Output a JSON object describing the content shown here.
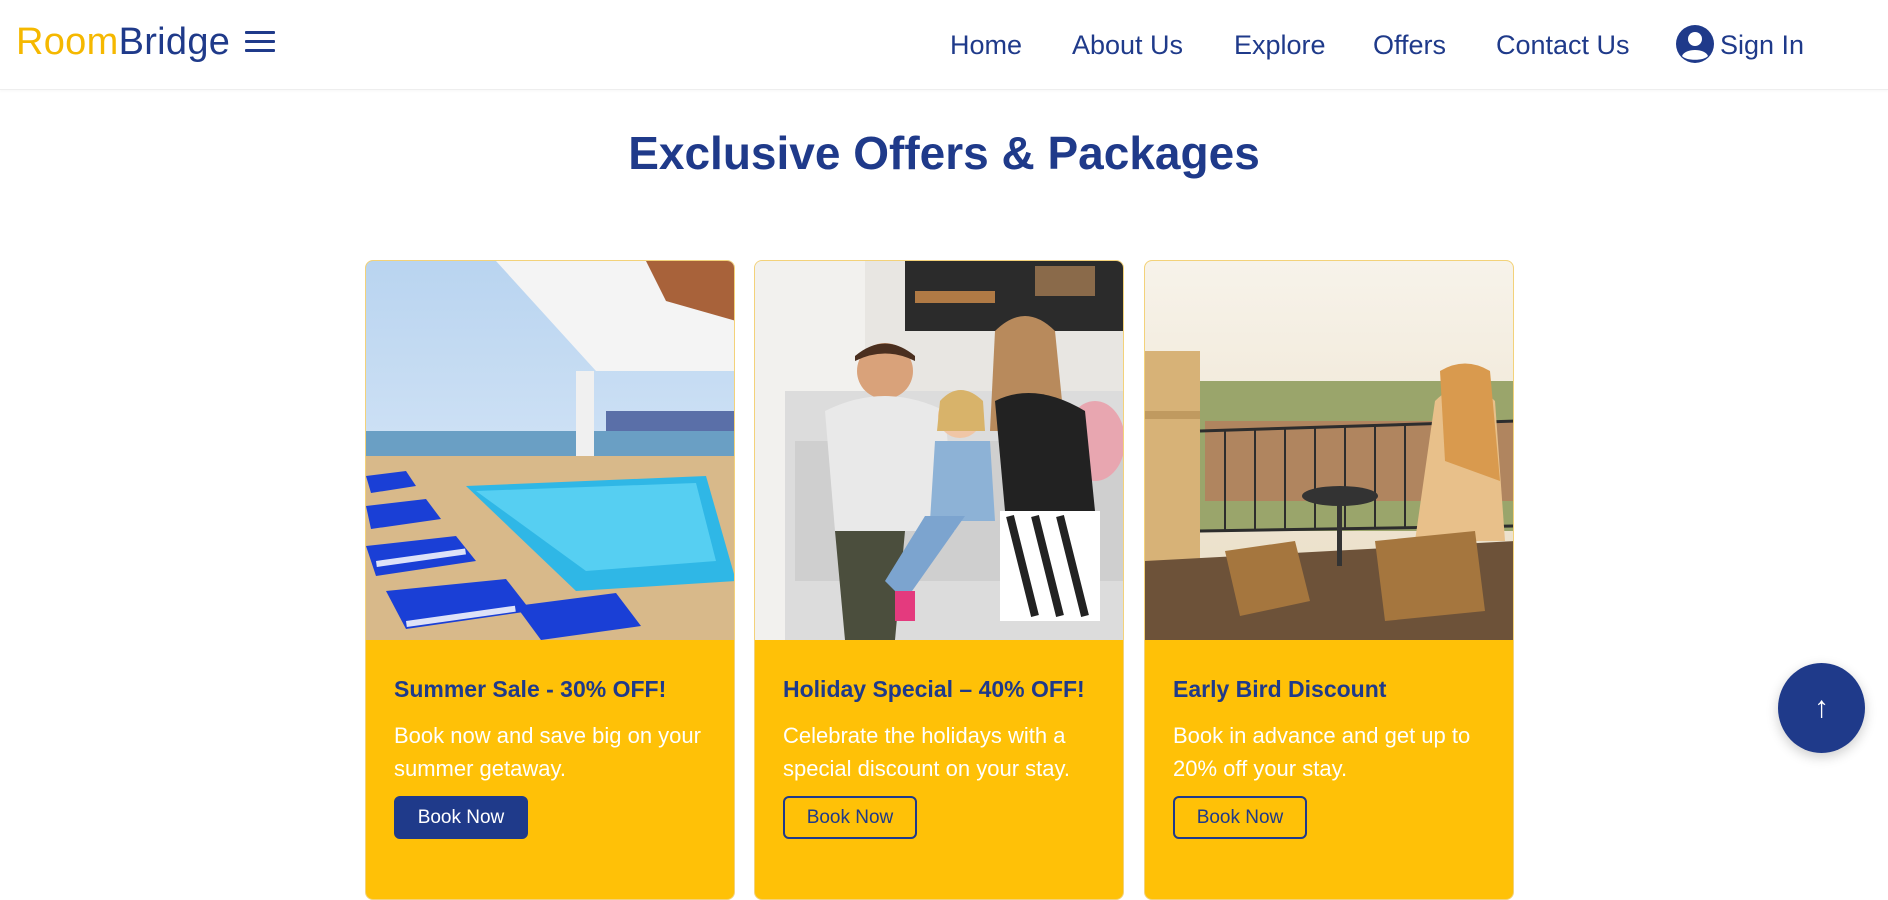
{
  "brand": {
    "part1": "Room",
    "part2": "Bridge"
  },
  "nav": {
    "items": [
      {
        "label": "Home"
      },
      {
        "label": "About Us"
      },
      {
        "label": "Explore"
      },
      {
        "label": "Offers"
      },
      {
        "label": "Contact Us"
      }
    ],
    "signin_label": "Sign In"
  },
  "section": {
    "title": "Exclusive Offers & Packages"
  },
  "offers": [
    {
      "title": "Summer Sale - 30% OFF!",
      "description": "Book now and save big on your summer getaway.",
      "button_label": "Book Now",
      "image": "rooftop-pool-photo"
    },
    {
      "title": "Holiday Special – 40% OFF!",
      "description": "Celebrate the holidays with a special discount on your stay.",
      "button_label": "Book Now",
      "image": "family-on-sofa-photo"
    },
    {
      "title": "Early Bird Discount",
      "description": "Book in advance and get up to 20% off your stay.",
      "button_label": "Book Now",
      "image": "balcony-breakfast-photo"
    }
  ],
  "scroll_top": {
    "icon": "arrow-up-icon",
    "glyph": "↑"
  },
  "colors": {
    "primary": "#1f3a8a",
    "accent": "#ffc107",
    "logo_yellow": "#f5b800"
  }
}
